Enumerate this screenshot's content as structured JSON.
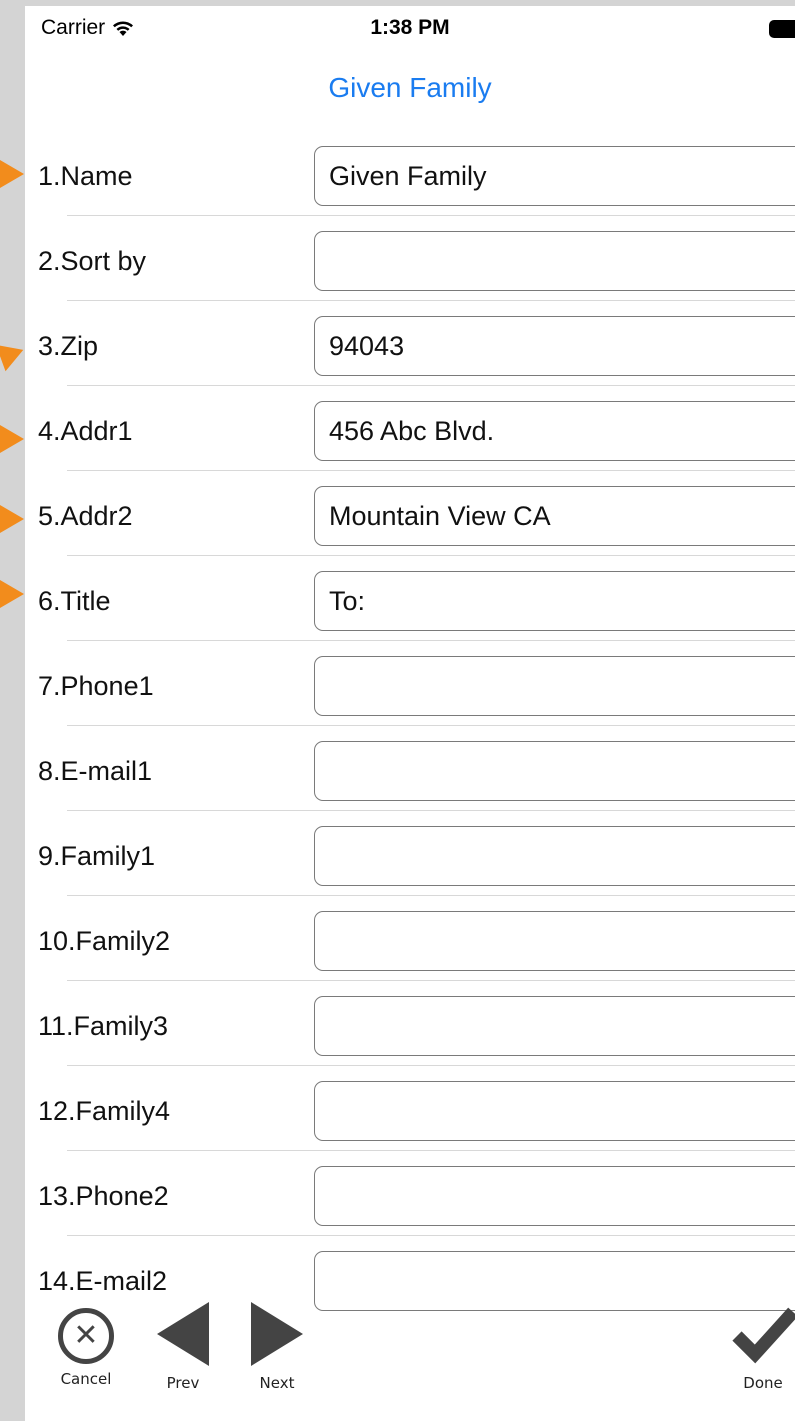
{
  "status_bar": {
    "carrier": "Carrier",
    "time": "1:38 PM"
  },
  "nav": {
    "title": "Given Family"
  },
  "fields": [
    {
      "label": "1.Name",
      "value": "Given Family"
    },
    {
      "label": "2.Sort by",
      "value": ""
    },
    {
      "label": "3.Zip",
      "value": "94043"
    },
    {
      "label": "4.Addr1",
      "value": "456 Abc Blvd."
    },
    {
      "label": "5.Addr2",
      "value": "Mountain View CA"
    },
    {
      "label": "6.Title",
      "value": "To:"
    },
    {
      "label": "7.Phone1",
      "value": ""
    },
    {
      "label": "8.E-mail1",
      "value": ""
    },
    {
      "label": "9.Family1",
      "value": ""
    },
    {
      "label": "10.Family2",
      "value": ""
    },
    {
      "label": "11.Family3",
      "value": ""
    },
    {
      "label": "12.Family4",
      "value": ""
    },
    {
      "label": "13.Phone2",
      "value": ""
    },
    {
      "label": "14.E-mail2",
      "value": ""
    }
  ],
  "toolbar": {
    "cancel": "Cancel",
    "prev": "Prev",
    "next": "Next",
    "done": "Done"
  },
  "colors": {
    "accent": "#1a7cf0",
    "marker": "#f28c1c",
    "icon": "#444444"
  }
}
